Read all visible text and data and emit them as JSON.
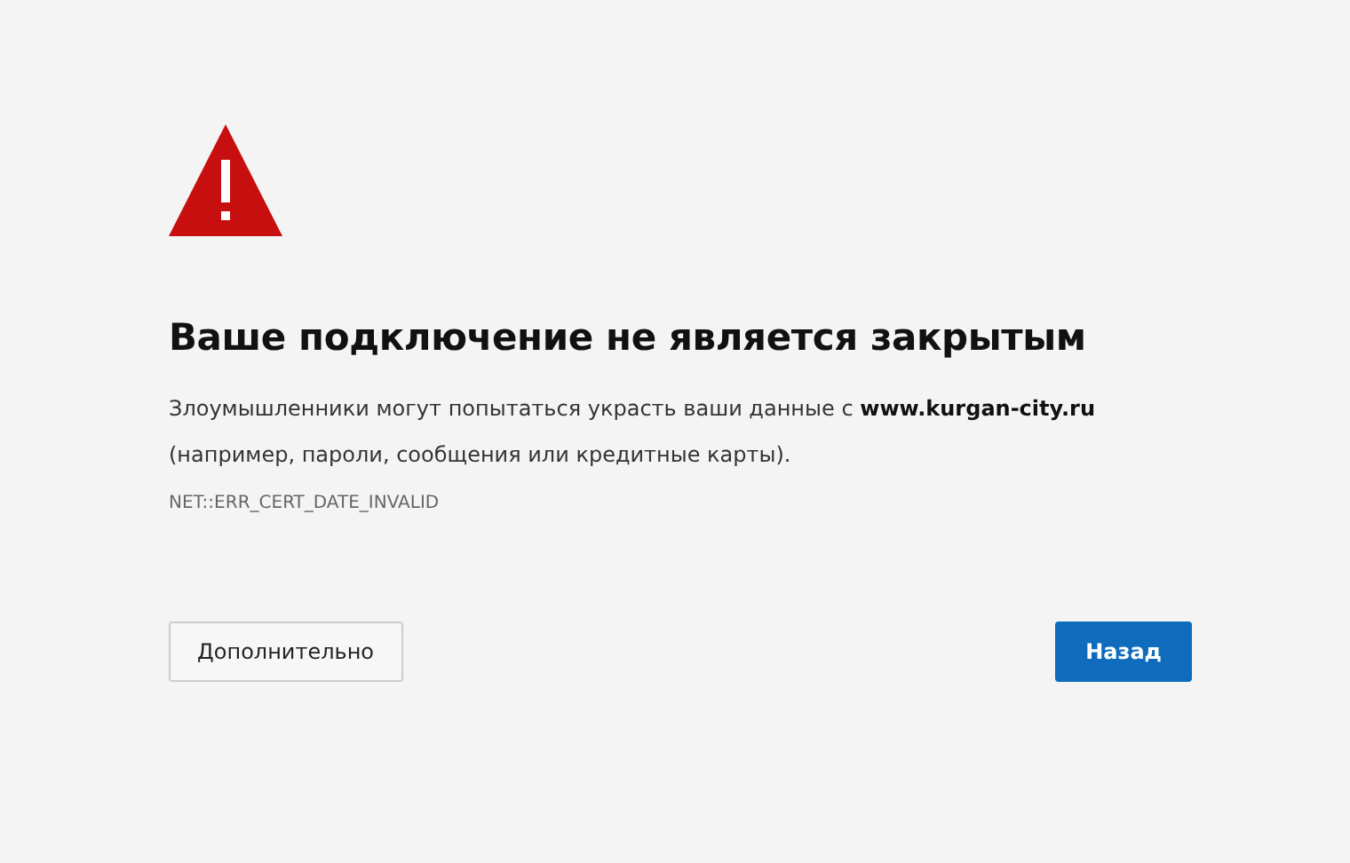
{
  "heading": "Ваше подключение не является закрытым",
  "description": "Злоумышленники могут попытаться украсть ваши данные с **www.kurgan-city.ru** (например, пароли, сообщения или кредитные карты).",
  "error_code": "NET::ERR_CERT_DATE_INVALID",
  "buttons": [
    {
      "label": "Дополнительно",
      "kind": "secondary"
    },
    {
      "label": "Назад",
      "kind": "primary"
    }
  ]
}
